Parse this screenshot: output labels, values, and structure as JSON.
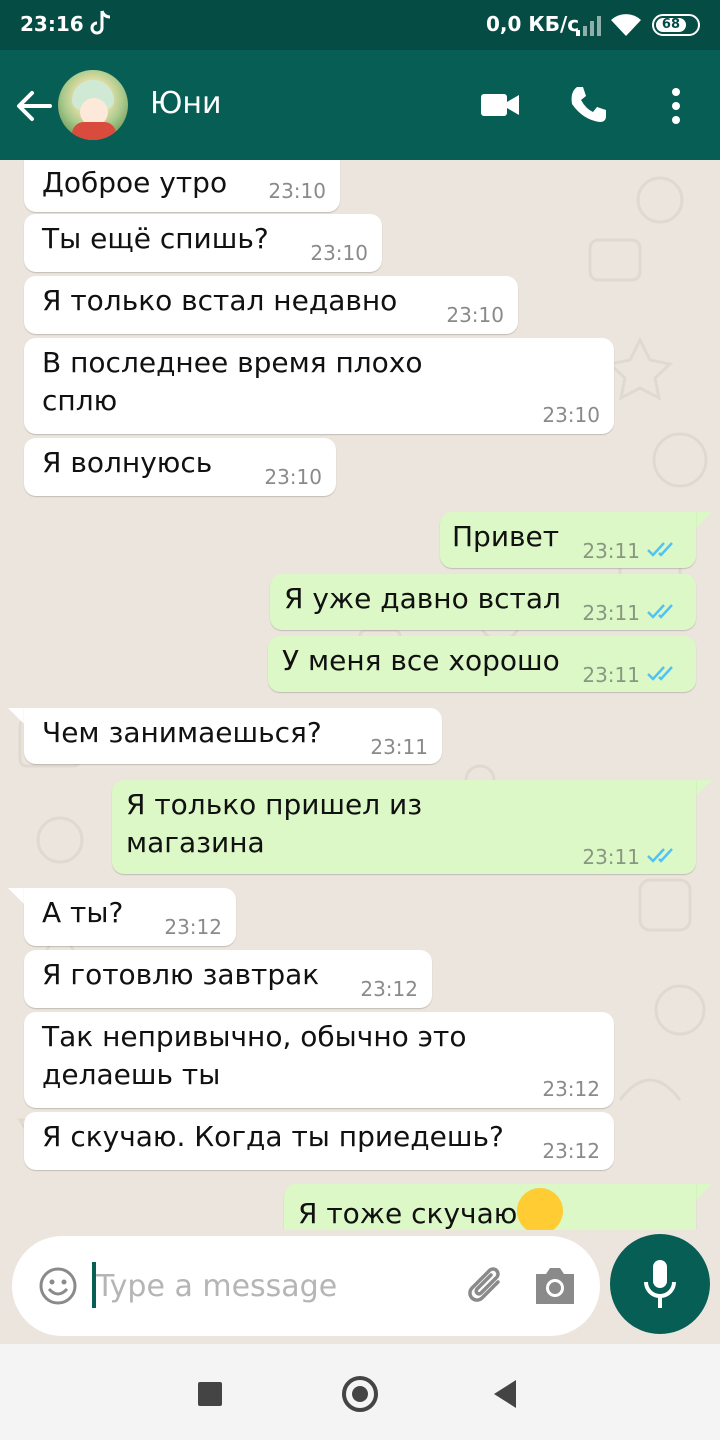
{
  "status_bar": {
    "time": "23:16",
    "network_speed": "0,0 КБ/с",
    "battery": "68",
    "icons": [
      "tiktok-note-icon",
      "signal-icon",
      "wifi-icon",
      "battery-icon"
    ]
  },
  "header": {
    "contact_name": "Юни",
    "icons": [
      "back-arrow-icon",
      "video-call-icon",
      "phone-icon",
      "more-vert-icon"
    ],
    "color": "#075e54"
  },
  "messages": [
    {
      "dir": "in",
      "text": "Доброе утро",
      "time": "23:10"
    },
    {
      "dir": "in",
      "text": "Ты ещё спишь?",
      "time": "23:10"
    },
    {
      "dir": "in",
      "text": "Я только встал недавно",
      "time": "23:10"
    },
    {
      "dir": "in",
      "text": "В последнее время плохо сплю",
      "time": "23:10"
    },
    {
      "dir": "in",
      "text": "Я волнуюсь",
      "time": "23:10"
    },
    {
      "dir": "out",
      "text": "Привет",
      "time": "23:11",
      "status": "read"
    },
    {
      "dir": "out",
      "text": "Я уже давно встал",
      "time": "23:11",
      "status": "read"
    },
    {
      "dir": "out",
      "text": "У меня все хорошо",
      "time": "23:11",
      "status": "read"
    },
    {
      "dir": "in",
      "text": "Чем занимаешься?",
      "time": "23:11"
    },
    {
      "dir": "out",
      "text": "Я только пришел из магазина",
      "time": "23:11",
      "status": "read"
    },
    {
      "dir": "in",
      "text": "А ты?",
      "time": "23:12"
    },
    {
      "dir": "in",
      "text": "Я готовлю завтрак",
      "time": "23:12"
    },
    {
      "dir": "in",
      "text": "Так непривычно, обычно это делаешь ты",
      "time": "23:12"
    },
    {
      "dir": "in",
      "text": "Я скучаю. Когда ты приедешь?",
      "time": "23:12"
    },
    {
      "dir": "out",
      "text": "Я тоже скучаю",
      "emoji": "pensive-face-emoji",
      "status": "read"
    }
  ],
  "input": {
    "placeholder": "Type a message",
    "icons": [
      "emoji-icon",
      "attach-icon",
      "camera-icon",
      "mic-icon"
    ]
  },
  "colors": {
    "incoming_bubble": "#ffffff",
    "outgoing_bubble": "#dcf8c6",
    "read_ticks": "#4fc3f7",
    "chat_background": "#ece5dd"
  }
}
